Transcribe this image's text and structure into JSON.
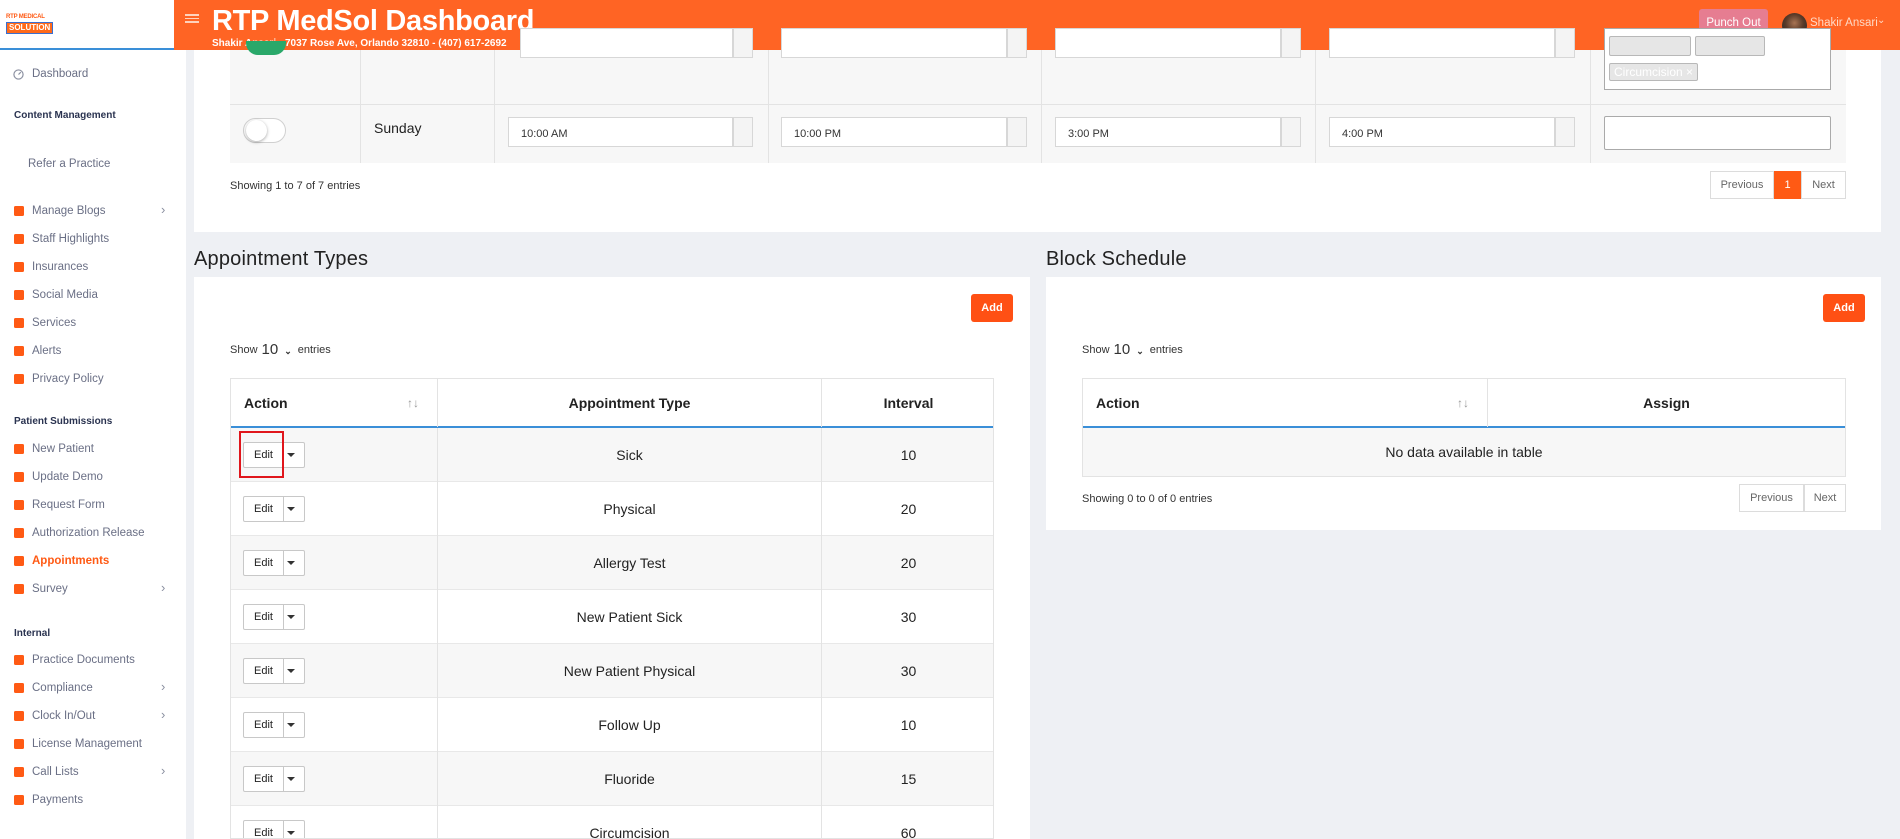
{
  "header": {
    "logo_line1": "RTP MEDICAL",
    "logo_line2": "SOLUTION",
    "title": "RTP MedSol Dashboard",
    "subtitle": "Shakir Ansari - 7037 Rose Ave, Orlando 32810 - (407) 617-2692",
    "punch_out": "Punch Out",
    "user_name": "Shakir Ansari",
    "user_chevron": "⌄"
  },
  "sidebar": {
    "dashboard": "Dashboard",
    "sec_content": "Content Management",
    "refer": "Refer a Practice",
    "items_content": [
      {
        "label": "Manage Blogs",
        "icon": "rss-icon",
        "chev": "›"
      },
      {
        "label": "Staff Highlights",
        "icon": "person-icon"
      },
      {
        "label": "Insurances",
        "icon": "briefcase-icon"
      },
      {
        "label": "Social Media",
        "icon": "social-icon"
      },
      {
        "label": "Services",
        "icon": "bell-icon"
      },
      {
        "label": "Alerts",
        "icon": "phone-icon"
      },
      {
        "label": "Privacy Policy",
        "icon": "shield-icon"
      }
    ],
    "sec_patient": "Patient Submissions",
    "items_patient": [
      {
        "label": "New Patient",
        "icon": "home-icon"
      },
      {
        "label": "Update Demo",
        "icon": "id-card-icon"
      },
      {
        "label": "Request Form",
        "icon": "document-icon"
      },
      {
        "label": "Authorization Release",
        "icon": "check-doc-icon"
      },
      {
        "label": "Appointments",
        "icon": "calendar-icon",
        "active": true
      },
      {
        "label": "Survey",
        "icon": "chart-icon",
        "chev": "›"
      }
    ],
    "sec_internal": "Internal",
    "items_internal": [
      {
        "label": "Practice Documents",
        "icon": "clipboard-icon"
      },
      {
        "label": "Compliance",
        "icon": "signature-icon",
        "chev": "›"
      },
      {
        "label": "Clock In/Out",
        "icon": "clock-icon",
        "chev": "›"
      },
      {
        "label": "License Management",
        "icon": "clipboard-list-icon"
      },
      {
        "label": "Call Lists",
        "icon": "phone-icon",
        "chev": "›"
      },
      {
        "label": "Payments",
        "icon": "money-icon"
      }
    ]
  },
  "schedule": {
    "tag_text": "Circumcision ×",
    "day": "Sunday",
    "open": "10:00 AM",
    "close": "10:00 PM",
    "break_start": "3:00 PM",
    "break_end": "4:00 PM",
    "showing": "Showing 1 to 7 of 7 entries",
    "prev": "Previous",
    "page": "1",
    "next": "Next"
  },
  "appointment_types": {
    "title": "Appointment Types",
    "add": "Add",
    "show_label": "Show",
    "show_value": "10",
    "entries_label": "entries",
    "chevron": "⌄",
    "sort_icon": "↑↓",
    "col_action": "Action",
    "col_type": "Appointment Type",
    "col_interval": "Interval",
    "edit_label": "Edit",
    "rows": [
      {
        "type": "Sick",
        "interval": "10"
      },
      {
        "type": "Physical",
        "interval": "20"
      },
      {
        "type": "Allergy Test",
        "interval": "20"
      },
      {
        "type": "New Patient Sick",
        "interval": "30"
      },
      {
        "type": "New Patient Physical",
        "interval": "30"
      },
      {
        "type": "Follow Up",
        "interval": "10"
      },
      {
        "type": "Fluoride",
        "interval": "15"
      },
      {
        "type": "Circumcision",
        "interval": "60"
      }
    ]
  },
  "block_schedule": {
    "title": "Block Schedule",
    "add": "Add",
    "show_label": "Show",
    "show_value": "10",
    "entries_label": "entries",
    "chevron": "⌄",
    "sort_icon": "↑↓",
    "col_action": "Action",
    "col_assign": "Assign",
    "empty": "No data available in table",
    "showing": "Showing 0 to 0 of 0 entries",
    "prev": "Previous",
    "next": "Next"
  },
  "colors": {
    "brand": "#ff6424",
    "accent": "#ff5014",
    "highlight": "#e0161c"
  }
}
